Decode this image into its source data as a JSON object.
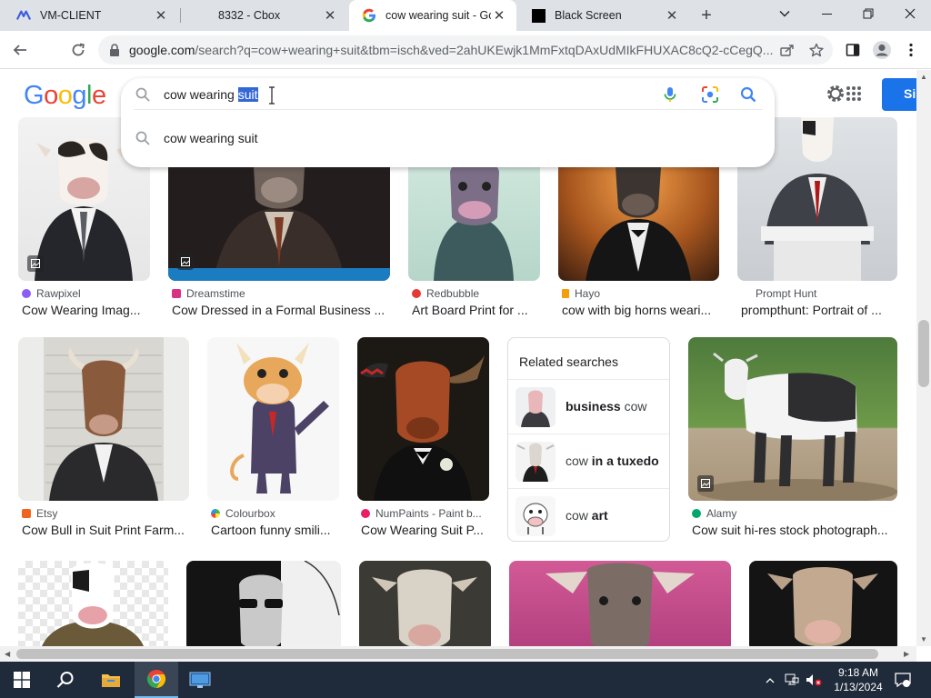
{
  "browser": {
    "tabs": [
      {
        "title": "VM-CLIENT",
        "active": false
      },
      {
        "title": "8332 - Cbox",
        "active": false
      },
      {
        "title": "cow wearing suit - Goo",
        "active": true
      },
      {
        "title": "Black Screen",
        "active": false
      }
    ],
    "new_tab_label": "+",
    "url_host": "google.com",
    "url_path": "/search?q=cow+wearing+suit&tbm=isch&ved=2ahUKEwjk1MmFxtqDAxUdMIkFHUXAC8cQ2-cCegQ..."
  },
  "google": {
    "logo_letters": [
      "G",
      "o",
      "o",
      "g",
      "l",
      "e"
    ],
    "logo_colors": [
      "#4285f4",
      "#ea4335",
      "#fbbc05",
      "#4285f4",
      "#34a853",
      "#ea4335"
    ],
    "signin_label": "Si",
    "search": {
      "query_prefix": "cow wearing ",
      "query_selected": "suit",
      "suggestion": "cow wearing suit"
    }
  },
  "results": {
    "row1": [
      {
        "source": "Rawpixel",
        "title": "Cow Wearing Imag...",
        "dot": "#8b5cf6"
      },
      {
        "source": "Dreamstime",
        "title": "Cow Dressed in a Formal Business ...",
        "dot": "#d63384"
      },
      {
        "source": "Redbubble",
        "title": "Art Board Print for ...",
        "dot": "#e53935"
      },
      {
        "source": "Hayo",
        "title": "cow with big horns weari...",
        "dot": "#f59e0b"
      },
      {
        "source": "Prompt Hunt",
        "title": "prompthunt: Portrait of ...",
        "dot": "#ffffff"
      }
    ],
    "row2": [
      {
        "source": "Etsy",
        "title": "Cow Bull in Suit Print Farm...",
        "dot": "#f1641e"
      },
      {
        "source": "Colourbox",
        "title": "Cartoon funny smili...",
        "dot": "#4caf50"
      },
      {
        "source": "NumPaints - Paint b...",
        "title": "Cow Wearing Suit P...",
        "dot": "#e91e63"
      },
      {
        "source": "Alamy",
        "title": "Cow suit hi-res stock photograph...",
        "dot": "#00a86b"
      }
    ],
    "related": {
      "heading": "Related searches",
      "items": [
        {
          "bold": "business",
          "rest": " cow",
          "bold_first": true
        },
        {
          "bold": "in a tuxedo",
          "rest": "cow ",
          "bold_first": false
        },
        {
          "bold": "art",
          "rest": "cow ",
          "bold_first": false
        }
      ]
    }
  },
  "taskbar": {
    "time": "9:18 AM",
    "date": "1/13/2024"
  }
}
